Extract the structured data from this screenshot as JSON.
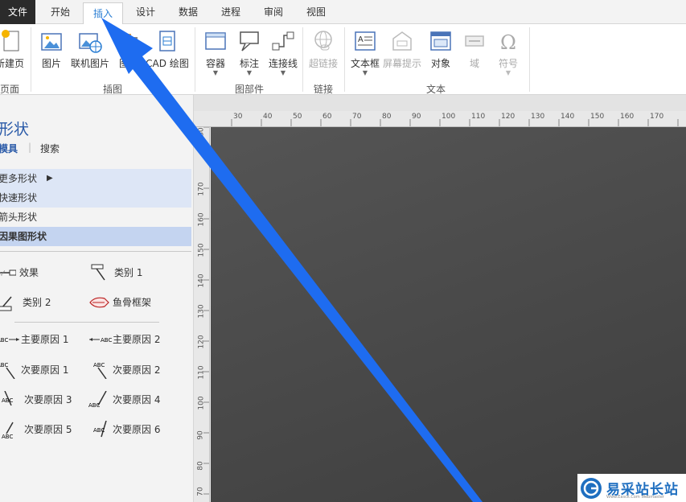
{
  "menubar": {
    "tabs": [
      "文件",
      "开始",
      "插入",
      "设计",
      "数据",
      "进程",
      "审阅",
      "视图"
    ],
    "active": "插入"
  },
  "ribbon": {
    "buttons": {
      "new_page": "新建页",
      "picture": "图片",
      "online_picture": "联机图片",
      "chart": "图表",
      "cad": "CAD 绘图",
      "container": "容器",
      "callout": "标注",
      "connector": "连接线",
      "hyperlink": "超链接",
      "textbox": "文本框",
      "screentip": "屏幕提示",
      "object": "对象",
      "field": "域",
      "symbol": "符号"
    },
    "groups": {
      "pages": "页面",
      "illustrations": "插图",
      "diagram_parts": "图部件",
      "links": "链接",
      "text": "文本"
    }
  },
  "panel": {
    "title": "形状",
    "tab_stencils": "模具",
    "tab_search": "搜索",
    "library": [
      "更多形状",
      "快速形状",
      "箭头形状",
      "因果图形状"
    ],
    "shapes": [
      [
        "效果",
        "类别 1"
      ],
      [
        "类别 2",
        "鱼骨框架"
      ],
      [
        "主要原因 1",
        "主要原因 2"
      ],
      [
        "次要原因 1",
        "次要原因 2"
      ],
      [
        "次要原因 3",
        "次要原因 4"
      ],
      [
        "次要原因 5",
        "次要原因 6"
      ]
    ]
  },
  "ruler_top": [
    "30",
    "40",
    "50",
    "60",
    "70",
    "80",
    "90",
    "100",
    "110",
    "120",
    "130",
    "140",
    "150",
    "160",
    "170"
  ],
  "ruler_left": [
    "180",
    "170",
    "160",
    "150",
    "140",
    "130",
    "120",
    "110",
    "100",
    "90",
    "80",
    "70"
  ],
  "watermark": {
    "text": "易采站长站",
    "sub": "Www.Easck.Com Webmaster"
  },
  "colors": {
    "accent": "#2a7ed3",
    "arrow": "#1e6cf0",
    "canvas": "#454545"
  }
}
